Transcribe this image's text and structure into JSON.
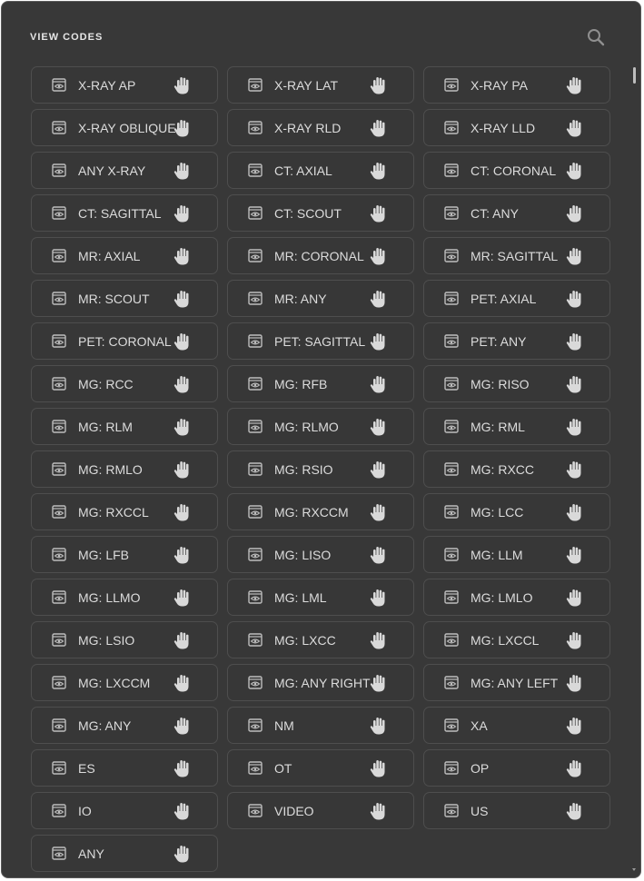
{
  "header": {
    "title": "VIEW CODES"
  },
  "icons": {
    "search": "search-icon",
    "view": "eye-icon",
    "drag": "hand-icon"
  },
  "codes": [
    "X-RAY AP",
    "X-RAY LAT",
    "X-RAY PA",
    "X-RAY OBLIQUE",
    "X-RAY RLD",
    "X-RAY LLD",
    "ANY X-RAY",
    "CT: AXIAL",
    "CT: CORONAL",
    "CT: SAGITTAL",
    "CT: SCOUT",
    "CT: ANY",
    "MR: AXIAL",
    "MR: CORONAL",
    "MR: SAGITTAL",
    "MR: SCOUT",
    "MR: ANY",
    "PET: AXIAL",
    "PET: CORONAL",
    "PET: SAGITTAL",
    "PET: ANY",
    "MG: RCC",
    "MG: RFB",
    "MG: RISO",
    "MG: RLM",
    "MG: RLMO",
    "MG: RML",
    "MG: RMLO",
    "MG: RSIO",
    "MG: RXCC",
    "MG: RXCCL",
    "MG: RXCCM",
    "MG: LCC",
    "MG: LFB",
    "MG: LISO",
    "MG: LLM",
    "MG: LLMO",
    "MG: LML",
    "MG: LMLO",
    "MG: LSIO",
    "MG: LXCC",
    "MG: LXCCL",
    "MG: LXCCM",
    "MG: ANY RIGHT",
    "MG: ANY LEFT",
    "MG: ANY",
    "NM",
    "XA",
    "ES",
    "OT",
    "OP",
    "IO",
    "VIDEO",
    "US",
    "ANY"
  ]
}
